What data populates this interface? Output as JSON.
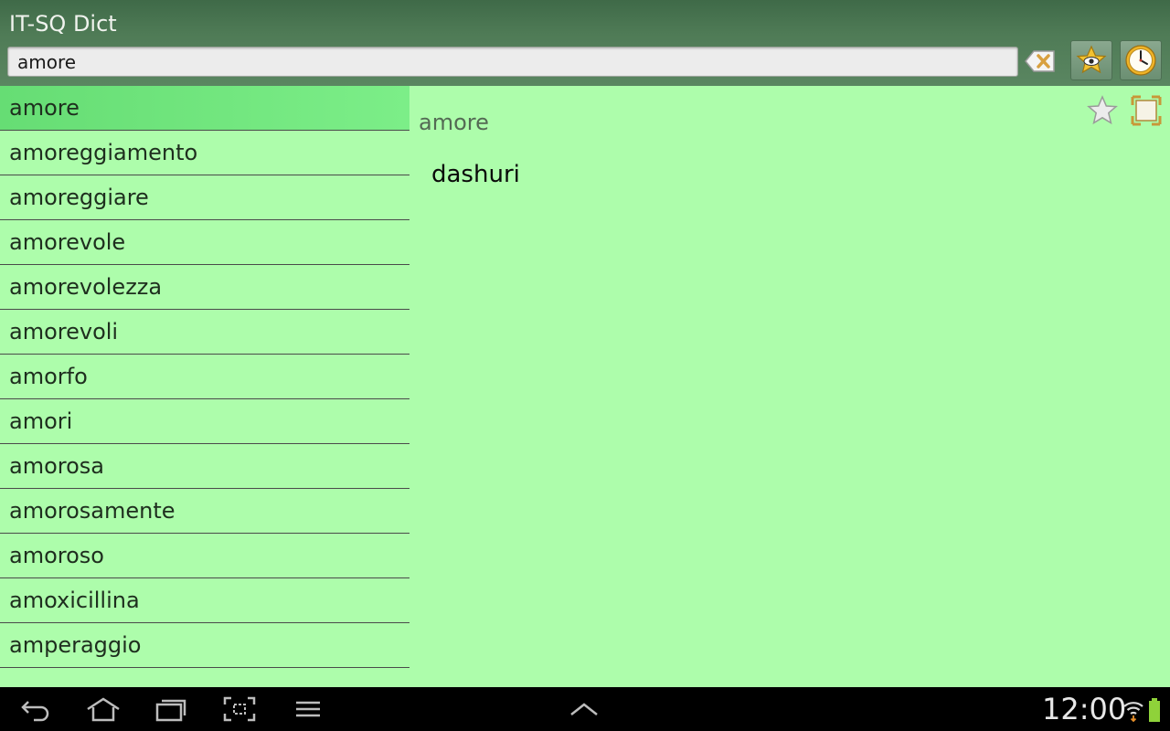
{
  "app": {
    "title": "IT-SQ Dict"
  },
  "search": {
    "value": "amore"
  },
  "word_list": {
    "items": [
      {
        "label": "amore",
        "selected": true
      },
      {
        "label": "amoreggiamento"
      },
      {
        "label": "amoreggiare"
      },
      {
        "label": "amorevole"
      },
      {
        "label": "amorevolezza"
      },
      {
        "label": "amorevoli"
      },
      {
        "label": "amorfo"
      },
      {
        "label": "amori"
      },
      {
        "label": "amorosa"
      },
      {
        "label": "amorosamente"
      },
      {
        "label": "amoroso"
      },
      {
        "label": "amoxicillina"
      },
      {
        "label": "amperaggio"
      }
    ]
  },
  "detail": {
    "headword": "amore",
    "translation": "dashuri"
  },
  "icons": {
    "clear": "backspace-clear-icon",
    "watch": "star-eye-icon",
    "history": "clock-icon",
    "favorite": "star-outline-icon",
    "fullscreen": "expand-icon"
  },
  "system_bar": {
    "time": "12:00"
  },
  "colors": {
    "header": "#4f7b56",
    "list_bg": "#adfdab",
    "selected": "#6ee47c"
  }
}
